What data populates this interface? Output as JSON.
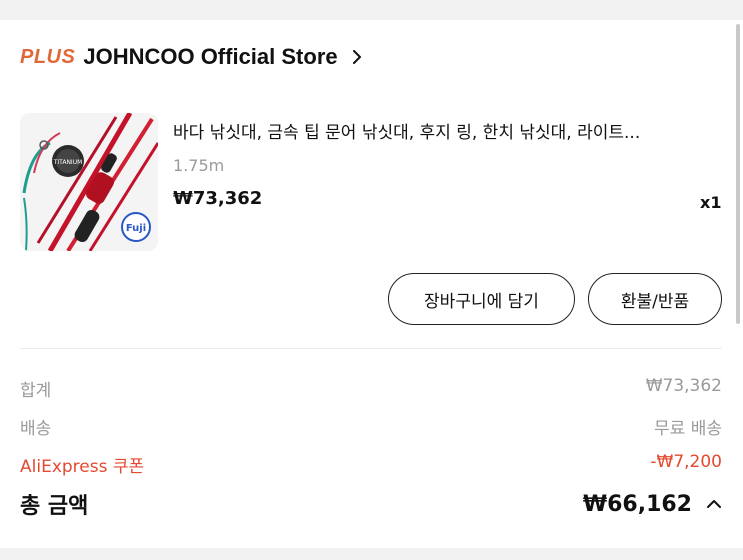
{
  "store": {
    "badge": "PLUS",
    "name": "JOHNCOO Official Store"
  },
  "product": {
    "image_alt": "fishing rod product photo",
    "title": "바다 낚싯대, 금속 팁 문어 낚싯대, 후지 링, 한치 낚싯대, 라이트...",
    "variant": "1.75m",
    "price": "₩73,362",
    "quantity": "x1",
    "image_labels": [
      "TITANIUM",
      "Fuji"
    ]
  },
  "actions": {
    "add_to_cart": "장바구니에 담기",
    "refund_return": "환불/반품"
  },
  "summary": {
    "subtotal_label": "합계",
    "subtotal_value": "₩73,362",
    "shipping_label": "배송",
    "shipping_value": "무료 배송",
    "coupon_label": "AliExpress 쿠폰",
    "coupon_value": "-₩7,200",
    "total_label": "총 금액",
    "total_value": "₩66,162"
  },
  "colors": {
    "accent_orange": "#e0693a",
    "coupon_red": "#e34a2f",
    "muted_text": "#9a9a9a"
  },
  "icons": {
    "store_chevron": "chevron-right-icon",
    "total_toggle": "chevron-up-icon"
  }
}
